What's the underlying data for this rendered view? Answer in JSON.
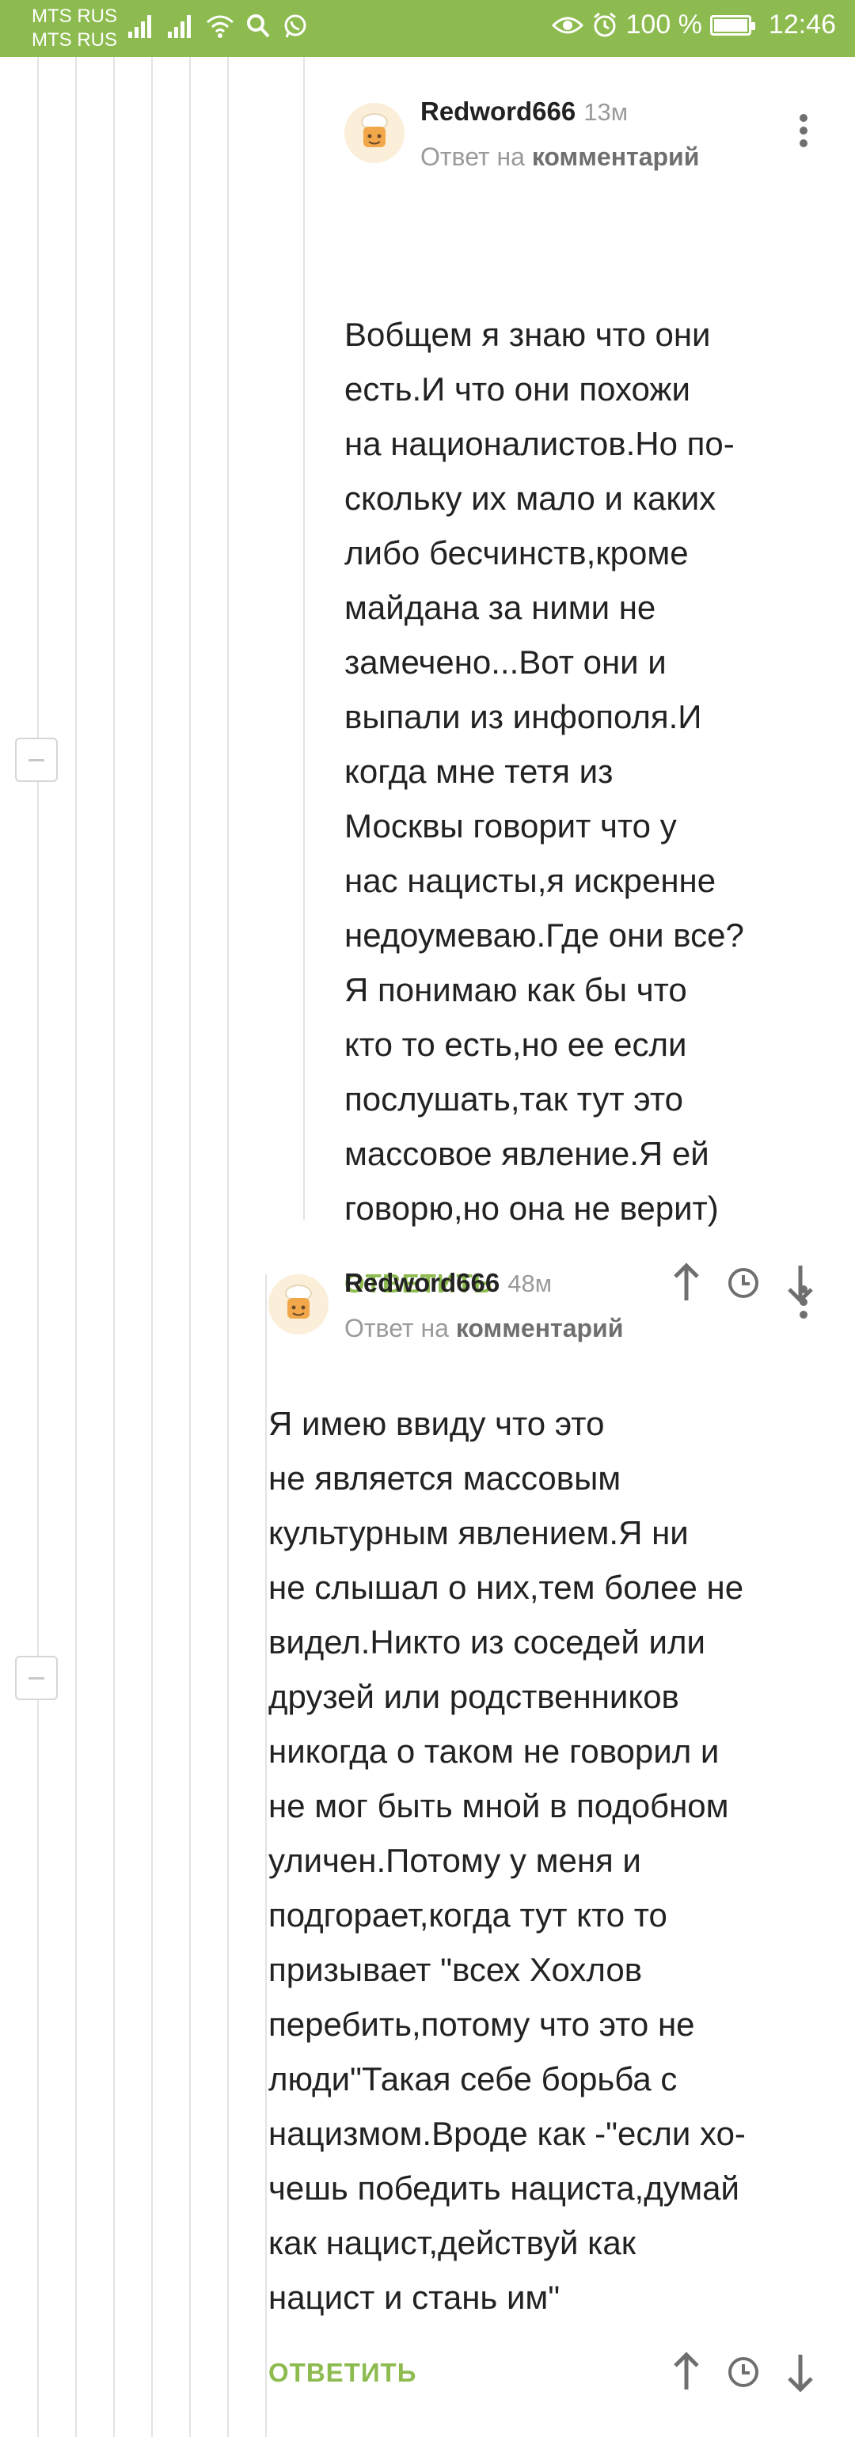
{
  "status_bar": {
    "carrier1": "MTS RUS",
    "carrier2": "MTS RUS",
    "battery": "100 %",
    "battery_level": 1.0,
    "time": "12:46",
    "icons": [
      "signal-icon",
      "signal-icon",
      "wifi-icon",
      "search-icon",
      "whatsapp-icon",
      "eye-icon",
      "alarm-icon",
      "battery-icon"
    ]
  },
  "comments": [
    {
      "author": "Redword666",
      "time": "13м",
      "reply_prefix": "Ответ на",
      "reply_link": "комментарий",
      "body": "Вобщем я знаю что они\nесть.И что они похожи\nна националистов.Но по-\nскольку их мало и каких\nлибо бесчинств,кроме\nмайдана за ними не\nзамечено...Вот они и\nвыпали из инфополя.И\nкогда мне тетя из\nМосквы говорит что у\nнас нацисты,я искренне\nнедоумеваю.Где они все?\nЯ понимаю как бы что\nкто то есть,но ее если\nпослушать,так тут это\nмассовое явление.Я ей\nговорю,но она не верит)",
      "reply_label": "ОТВЕТИТЬ"
    },
    {
      "author": "Redword666",
      "time": "48м",
      "reply_prefix": "Ответ на",
      "reply_link": "комментарий",
      "body": "Я имею ввиду что это\nне является массовым\nкультурным явлением.Я ни\nне слышал о них,тем более не\nвидел.Никто из соседей или\nдрузей или родственников\nникогда о таком не говорил и\nне мог быть мной в подобном\nуличен.Потому у меня и\nподгорает,когда тут кто то\nпризывает \"всех Хохлов\nперебить,потому что это не\nлюди\"Такая себе борьба с\nнацизмом.Вроде как -\"если хо-\nчешь победить нациста,думай\nкак нацист,действуй как\nнацист и стань им\"",
      "reply_label": "ОТВЕТИТЬ"
    }
  ],
  "colors": {
    "accent": "#8dbb4f",
    "text": "#222222",
    "muted": "#9a9a9a"
  }
}
